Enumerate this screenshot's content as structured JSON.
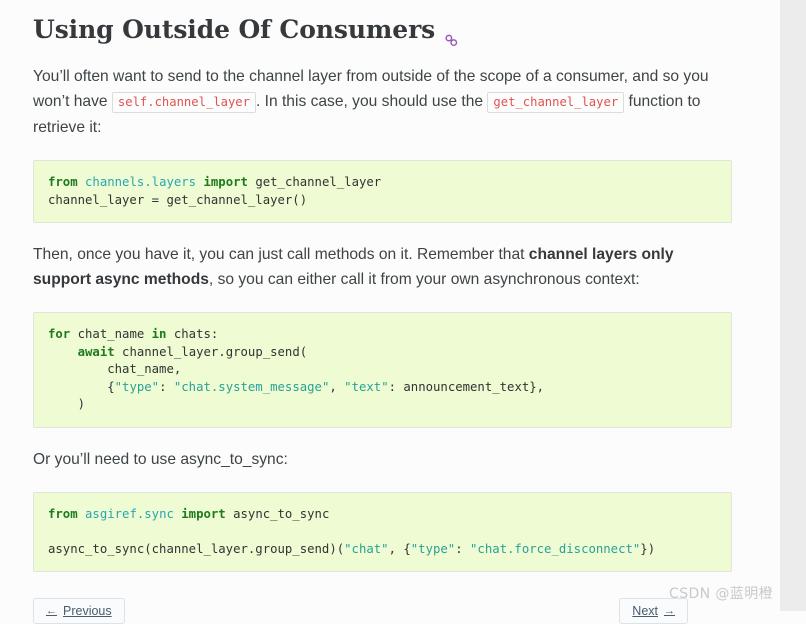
{
  "page": {
    "heading": "Using Outside Of Consumers",
    "anchor_icon": "link-icon"
  },
  "paragraphs": {
    "intro_part1": "You’ll often want to send to the channel layer from outside of the scope of a consumer, and so you won’t have ",
    "intro_code1": "self.channel_layer",
    "intro_part2": ". In this case, you should use the ",
    "intro_code2": "get_channel_layer",
    "intro_part3": " function to retrieve it:",
    "second_part1": "Then, once you have it, you can just call methods on it. Remember that ",
    "second_bold": "channel layers only support async methods",
    "second_part2": ", so you can either call it from your own asynchronous context:",
    "third": "Or you’ll need to use async_to_sync:"
  },
  "code_blocks": [
    {
      "name": "get-channel-layer-snippet",
      "lines": [
        [
          {
            "t": "from ",
            "c": "kw"
          },
          {
            "t": "channels.layers",
            "c": "mod"
          },
          {
            "t": " ",
            "c": "plain"
          },
          {
            "t": "import",
            "c": "kw"
          },
          {
            "t": " get_channel_layer",
            "c": "plain"
          }
        ],
        [
          {
            "t": "channel_layer = get_channel_layer()",
            "c": "plain"
          }
        ]
      ]
    },
    {
      "name": "async-group-send-snippet",
      "lines": [
        [
          {
            "t": "for",
            "c": "kw"
          },
          {
            "t": " chat_name ",
            "c": "plain"
          },
          {
            "t": "in",
            "c": "kw"
          },
          {
            "t": " chats:",
            "c": "plain"
          }
        ],
        [
          {
            "t": "    ",
            "c": "plain"
          },
          {
            "t": "await",
            "c": "kw"
          },
          {
            "t": " channel_layer.group_send(",
            "c": "plain"
          }
        ],
        [
          {
            "t": "        chat_name,",
            "c": "plain"
          }
        ],
        [
          {
            "t": "        {",
            "c": "plain"
          },
          {
            "t": "\"type\"",
            "c": "str"
          },
          {
            "t": ": ",
            "c": "plain"
          },
          {
            "t": "\"chat.system_message\"",
            "c": "str"
          },
          {
            "t": ", ",
            "c": "plain"
          },
          {
            "t": "\"text\"",
            "c": "str"
          },
          {
            "t": ": announcement_text},",
            "c": "plain"
          }
        ],
        [
          {
            "t": "    )",
            "c": "plain"
          }
        ]
      ]
    },
    {
      "name": "async-to-sync-snippet",
      "lines": [
        [
          {
            "t": "from ",
            "c": "kw"
          },
          {
            "t": "asgiref.sync",
            "c": "mod"
          },
          {
            "t": " ",
            "c": "plain"
          },
          {
            "t": "import",
            "c": "kw"
          },
          {
            "t": " async_to_sync",
            "c": "plain"
          }
        ],
        [
          {
            "t": "",
            "c": "plain"
          }
        ],
        [
          {
            "t": "async_to_sync(channel_layer.group_send)(",
            "c": "plain"
          },
          {
            "t": "\"chat\"",
            "c": "str"
          },
          {
            "t": ", {",
            "c": "plain"
          },
          {
            "t": "\"type\"",
            "c": "str"
          },
          {
            "t": ": ",
            "c": "plain"
          },
          {
            "t": "\"chat.force_disconnect\"",
            "c": "str"
          },
          {
            "t": "})",
            "c": "plain"
          }
        ]
      ]
    }
  ],
  "bottom_nav": {
    "previous_label": "Previous",
    "previous_arrow": "←",
    "next_label": "Next",
    "next_arrow": "→"
  },
  "watermark": {
    "text": "CSDN @蓝明橙"
  },
  "colors": {
    "code_block_bg": "#eefbd3",
    "inline_code_text": "#e05252",
    "keyword": "#1f7a1f",
    "module": "#2aa6b0",
    "string": "#2aa198",
    "heading": "#36393c",
    "anchor_icon": "#9b59b6"
  }
}
